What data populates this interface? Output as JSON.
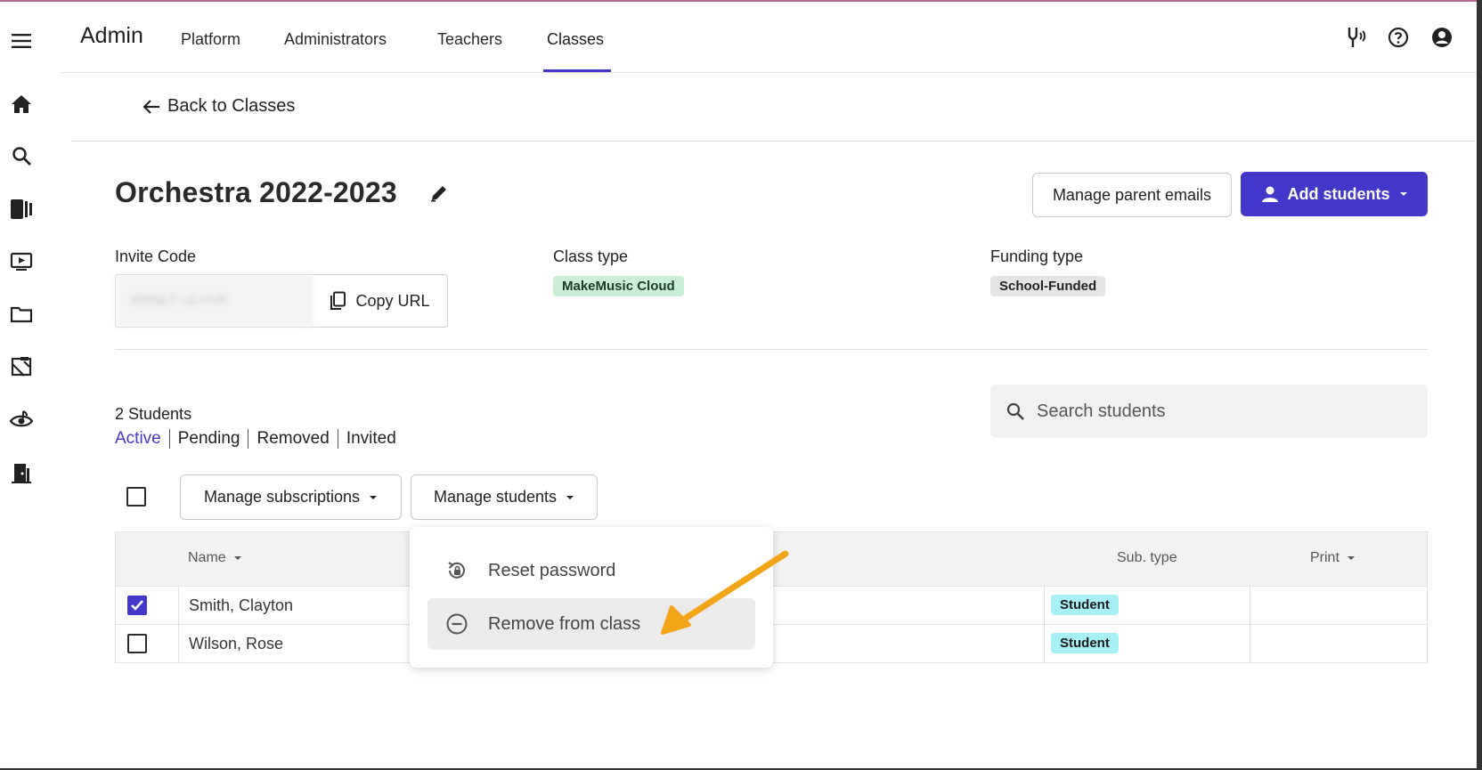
{
  "nav": {
    "brand": "Admin",
    "tabs": [
      {
        "label": "Platform"
      },
      {
        "label": "Administrators"
      },
      {
        "label": "Teachers"
      },
      {
        "label": "Classes"
      }
    ],
    "active_tab": "Classes"
  },
  "back_link": "Back to Classes",
  "class": {
    "title": "Orchestra 2022-2023",
    "manage_parent_emails": "Manage parent emails",
    "add_students": "Add students",
    "invite_code_label": "Invite Code",
    "invite_code_value": "W8NLT-ULHVK",
    "copy_url": "Copy URL",
    "class_type_label": "Class type",
    "class_type_value": "MakeMusic Cloud",
    "funding_type_label": "Funding type",
    "funding_type_value": "School-Funded"
  },
  "students": {
    "count_label": "2 Students",
    "filters": [
      "Active",
      "Pending",
      "Removed",
      "Invited"
    ],
    "active_filter": "Active",
    "search_placeholder": "Search students",
    "manage_subscriptions": "Manage subscriptions",
    "manage_students": "Manage students",
    "columns": {
      "name": "Name",
      "sub_type": "Sub. type",
      "print": "Print"
    },
    "rows": [
      {
        "name": "Smith, Clayton",
        "sub_type": "Student",
        "checked": true
      },
      {
        "name": "Wilson, Rose",
        "sub_type": "Student",
        "checked": false
      }
    ]
  },
  "menu": {
    "items": [
      {
        "label": "Reset password",
        "icon": "reset-password-icon"
      },
      {
        "label": "Remove from class",
        "icon": "remove-circle-icon"
      }
    ]
  },
  "colors": {
    "accent": "#4338ca",
    "class_type_badge": "#c9f0d6",
    "funding_badge": "#e4e4e4",
    "student_badge": "#a7f0f5",
    "annotation_arrow": "#f2a516"
  }
}
